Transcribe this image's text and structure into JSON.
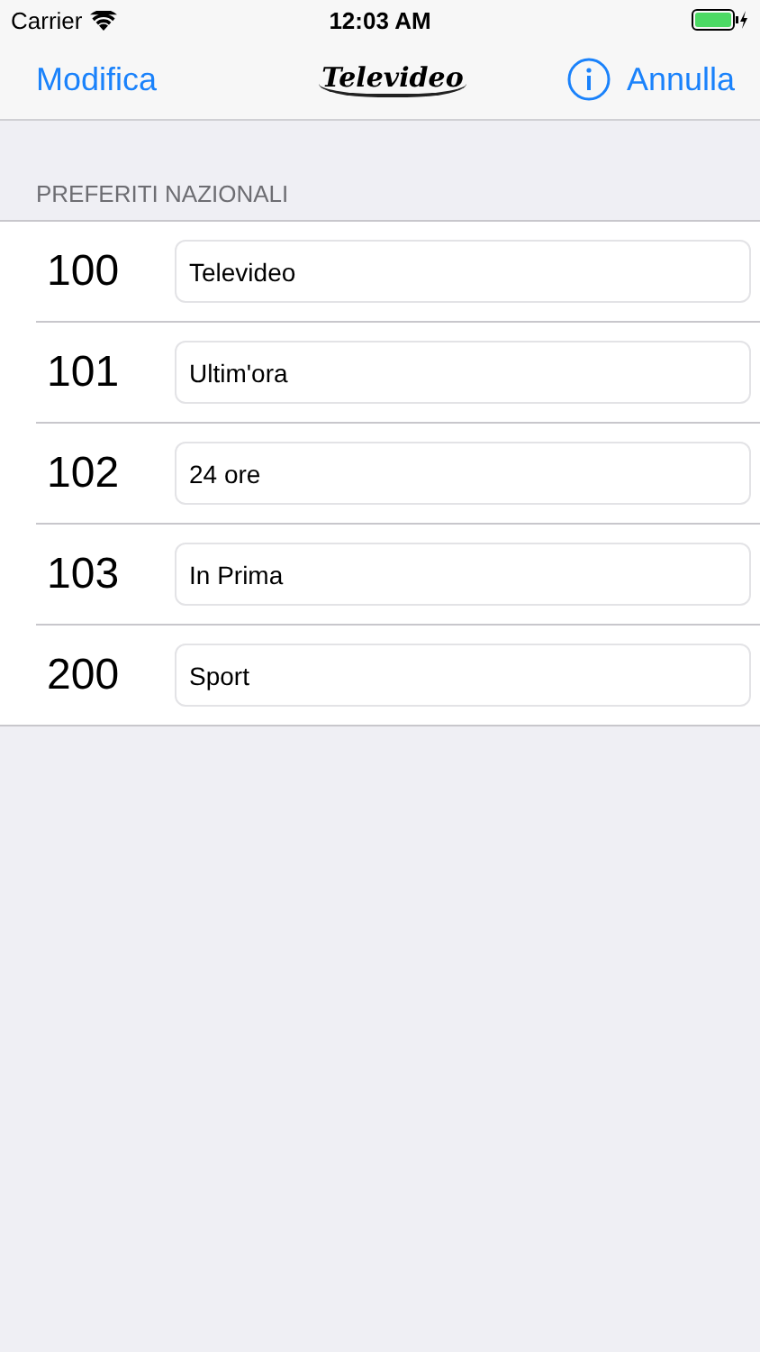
{
  "status_bar": {
    "carrier": "Carrier",
    "time": "12:03 AM"
  },
  "nav_bar": {
    "left_button": "Modifica",
    "logo": "Televideo",
    "right_button": "Annulla"
  },
  "section": {
    "title": "PREFERITI NAZIONALI",
    "rows": [
      {
        "page": "100",
        "value": "Televideo"
      },
      {
        "page": "101",
        "value": "Ultim'ora"
      },
      {
        "page": "102",
        "value": "24 ore"
      },
      {
        "page": "103",
        "value": "In Prima"
      },
      {
        "page": "200",
        "value": "Sport"
      }
    ]
  }
}
